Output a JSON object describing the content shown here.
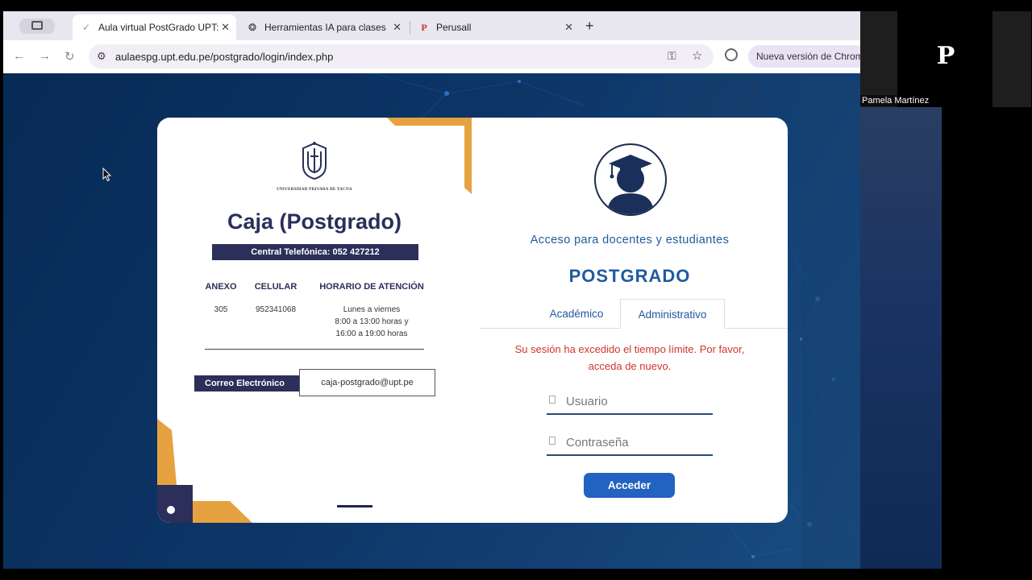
{
  "browser": {
    "tabs": [
      {
        "title": "Aula virtual PostGrado UPT: (",
        "icon": "check-favicon-icon",
        "active": true
      },
      {
        "title": "Herramientas IA para clases",
        "icon": "openai-favicon-icon",
        "active": false
      },
      {
        "title": "Perusall",
        "icon": "perusall-favicon-icon",
        "favicon_letter": "P",
        "active": false
      }
    ],
    "url": "aulaespg.upt.edu.pe/postgrado/login/index.php",
    "new_version_label": "Nueva versión de Chrome"
  },
  "left_panel": {
    "university_name": "UNIVERSIDAD PRIVADA DE TACNA",
    "title": "Caja (Postgrado)",
    "central": "Central Telefónica: 052 427212",
    "headers": {
      "anexo": "ANEXO",
      "celular": "CELULAR",
      "horario": "HORARIO DE ATENCIÓN"
    },
    "values": {
      "anexo": "305",
      "celular": "952341068",
      "horario_1": "Lunes a viernes",
      "horario_2": "8:00 a 13:00 horas y",
      "horario_3": "16:00 a 19:00 horas"
    },
    "email_label": "Correo Electrónico",
    "email": "caja-postgrado@upt.pe"
  },
  "login": {
    "heading": "Acceso para docentes y estudiantes",
    "program": "POSTGRADO",
    "tabs": [
      "Académico",
      "Administrativo"
    ],
    "active_tab": "Administrativo",
    "error_line1": "Su sesión ha excedido el tiempo límite. Por favor,",
    "error_line2": "acceda de nuevo.",
    "username_placeholder": "Usuario",
    "password_placeholder": "Contraseña",
    "submit": "Acceder"
  },
  "participant": {
    "initial": "P",
    "name": "Pamela Martínez"
  },
  "colors": {
    "navy": "#2b2f5a",
    "accent_orange": "#e6a240",
    "link_blue": "#1f5aa0",
    "button_blue": "#2262c0",
    "error_red": "#d0342c"
  }
}
